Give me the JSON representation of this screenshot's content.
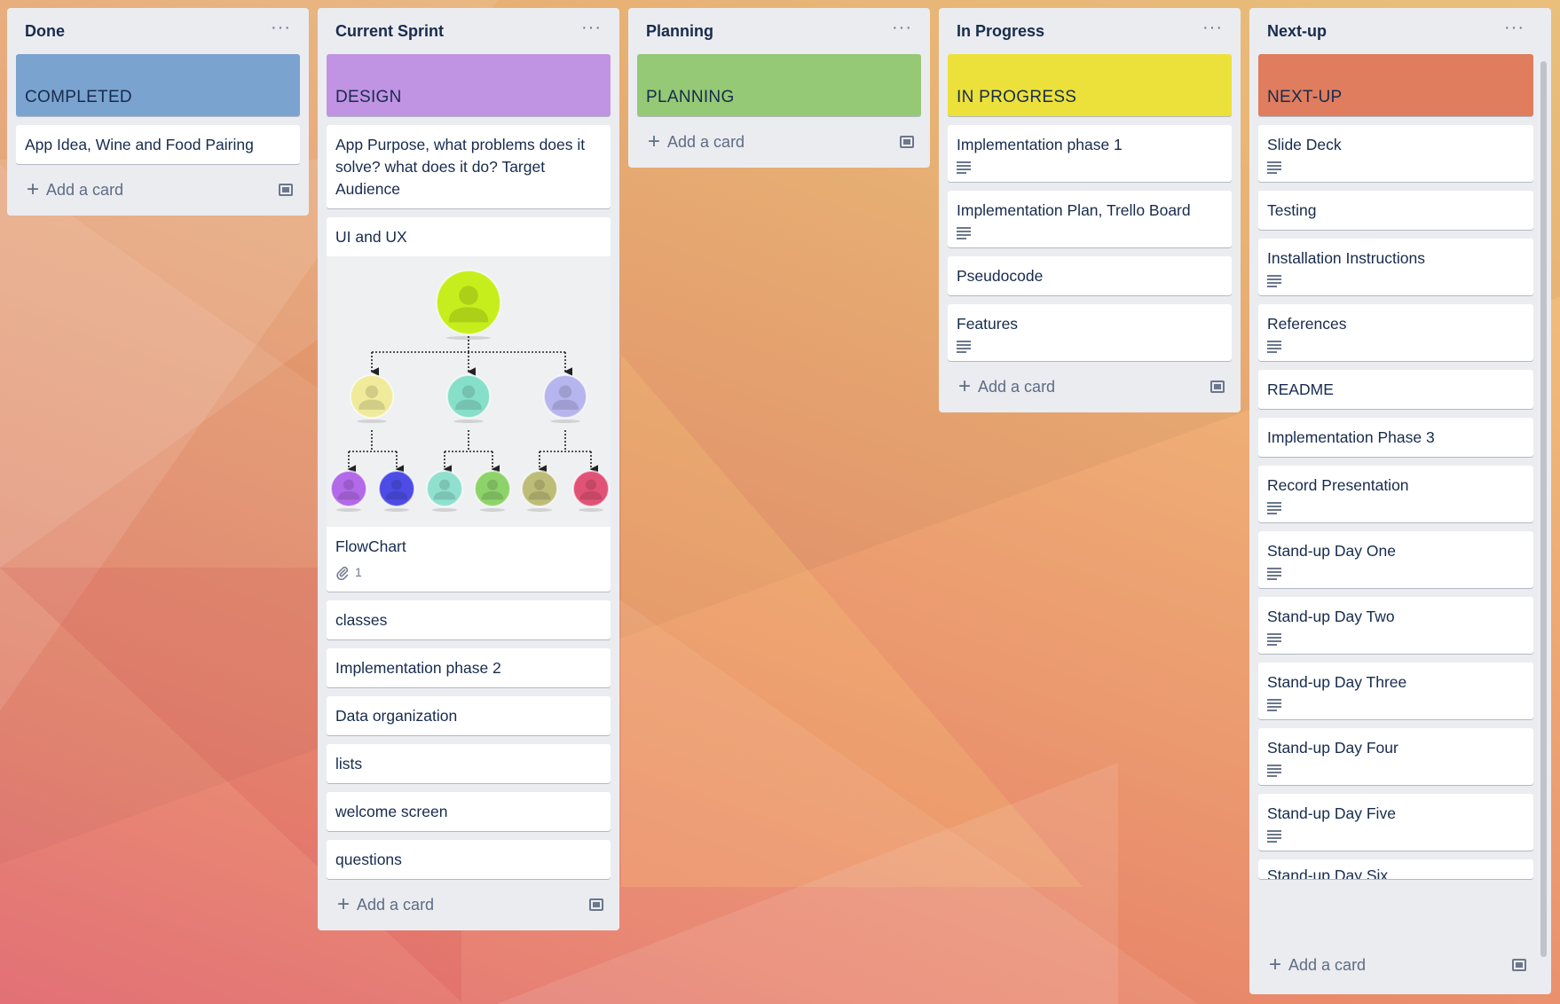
{
  "lists": {
    "done": {
      "title": "Done",
      "label": "COMPLETED",
      "label_color": "#7aa3d0",
      "cards": [
        "App Idea, Wine and Food Pairing"
      ],
      "add_label": "Add a card"
    },
    "sprint": {
      "title": "Current Sprint",
      "label": "DESIGN",
      "label_color": "#c193e3",
      "card_purpose": "App Purpose, what problems does it solve? what does it do? Target Audience",
      "card_ui": "UI and UX",
      "flowchart": {
        "title": "FlowChart",
        "attachments": "1"
      },
      "cards": [
        "classes",
        "Implementation phase 2",
        "Data organization",
        "lists",
        "welcome screen",
        "questions"
      ],
      "add_label": "Add a card"
    },
    "planning": {
      "title": "Planning",
      "label": "PLANNING",
      "label_color": "#95c975",
      "add_label": "Add a card"
    },
    "progress": {
      "title": "In Progress",
      "label": "IN PROGRESS",
      "label_color": "#ece13a",
      "cards": [
        {
          "title": "Implementation phase 1",
          "has_description": true
        },
        {
          "title": "Implementation Plan, Trello Board",
          "has_description": true
        },
        {
          "title": "Pseudocode",
          "has_description": false
        },
        {
          "title": "Features",
          "has_description": true
        }
      ],
      "add_label": "Add a card"
    },
    "nextup": {
      "title": "Next-up",
      "label": "NEXT-UP",
      "label_color": "#df7d5e",
      "cards": [
        {
          "title": "Slide Deck",
          "has_description": true
        },
        {
          "title": "Testing",
          "has_description": false
        },
        {
          "title": "Installation Instructions",
          "has_description": true
        },
        {
          "title": "References",
          "has_description": true
        },
        {
          "title": "README",
          "has_description": false
        },
        {
          "title": "Implementation Phase 3",
          "has_description": false
        },
        {
          "title": "Record Presentation",
          "has_description": true
        },
        {
          "title": "Stand-up Day One",
          "has_description": true
        },
        {
          "title": "Stand-up Day Two",
          "has_description": true
        },
        {
          "title": "Stand-up Day Three",
          "has_description": true
        },
        {
          "title": "Stand-up Day Four",
          "has_description": true
        },
        {
          "title": "Stand-up Day Five",
          "has_description": true
        }
      ],
      "partial_card": "Stand-up Day Six",
      "add_label": "Add a card"
    }
  },
  "colors": {
    "list_bg": "#ebecf0",
    "card_bg": "#ffffff",
    "text": "#172b4d",
    "muted": "#5e6c84"
  },
  "icons": [
    "more-icon",
    "plus-icon",
    "template-icon",
    "description-icon",
    "attachment-icon",
    "person-icon"
  ]
}
